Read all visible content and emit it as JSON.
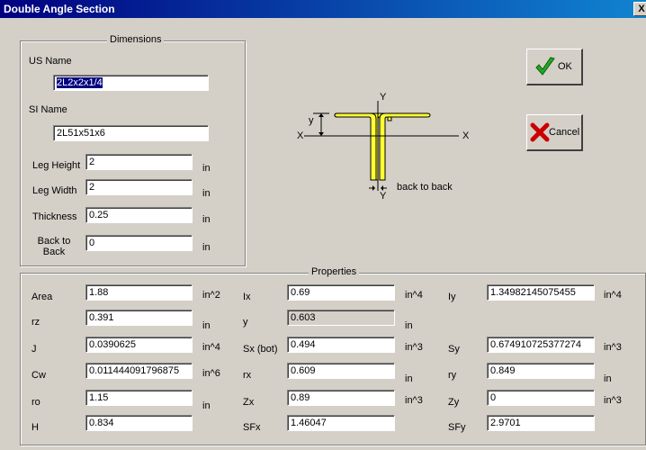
{
  "window": {
    "title": "Double Angle Section",
    "close": "X"
  },
  "dimensions": {
    "group_title": "Dimensions",
    "us_name_label": "US Name",
    "us_name_value": "2L2x2x1/4",
    "si_name_label": "SI Name",
    "si_name_value": "2L51x51x6",
    "leg_height_label": "Leg Height",
    "leg_height_value": "2",
    "leg_width_label": "Leg Width",
    "leg_width_value": "2",
    "thickness_label": "Thickness",
    "thickness_value": "0.25",
    "back_to_back_label": "Back to Back",
    "back_to_back_value": "0",
    "unit": "in"
  },
  "diagram": {
    "y_top": "Y",
    "y_bottom": "Y",
    "x_left": "X",
    "x_right": "X",
    "y_dim": "y",
    "back_to_back": "back to back"
  },
  "buttons": {
    "ok": "OK",
    "cancel": "Cancel"
  },
  "properties": {
    "group_title": "Properties",
    "rows": [
      [
        {
          "label": "Area",
          "value": "1.88",
          "unit": "in^2"
        },
        {
          "label": "Ix",
          "value": "0.69",
          "unit": "in^4"
        },
        {
          "label": "Iy",
          "value": "1.34982145075455",
          "unit": "in^4"
        }
      ],
      [
        {
          "label": "rz",
          "value": "0.391",
          "unit": "in"
        },
        {
          "label": "y",
          "value": "0.603",
          "unit": "in"
        },
        {
          "label": "",
          "value": "",
          "unit": ""
        }
      ],
      [
        {
          "label": "J",
          "value": "0.0390625",
          "unit": "in^4"
        },
        {
          "label": "Sx (bot)",
          "value": "0.494",
          "unit": "in^3"
        },
        {
          "label": "Sy",
          "value": "0.674910725377274",
          "unit": "in^3"
        }
      ],
      [
        {
          "label": "Cw",
          "value": "0.011444091796875",
          "unit": "in^6"
        },
        {
          "label": "rx",
          "value": "0.609",
          "unit": "in"
        },
        {
          "label": "ry",
          "value": "0.849",
          "unit": "in"
        }
      ],
      [
        {
          "label": "ro",
          "value": "1.15",
          "unit": "in"
        },
        {
          "label": "Zx",
          "value": "0.89",
          "unit": "in^3"
        },
        {
          "label": "Zy",
          "value": "0",
          "unit": "in^3"
        }
      ],
      [
        {
          "label": "H",
          "value": "0.834",
          "unit": ""
        },
        {
          "label": "SFx",
          "value": "1.46047",
          "unit": ""
        },
        {
          "label": "SFy",
          "value": "2.9701",
          "unit": ""
        }
      ]
    ]
  }
}
